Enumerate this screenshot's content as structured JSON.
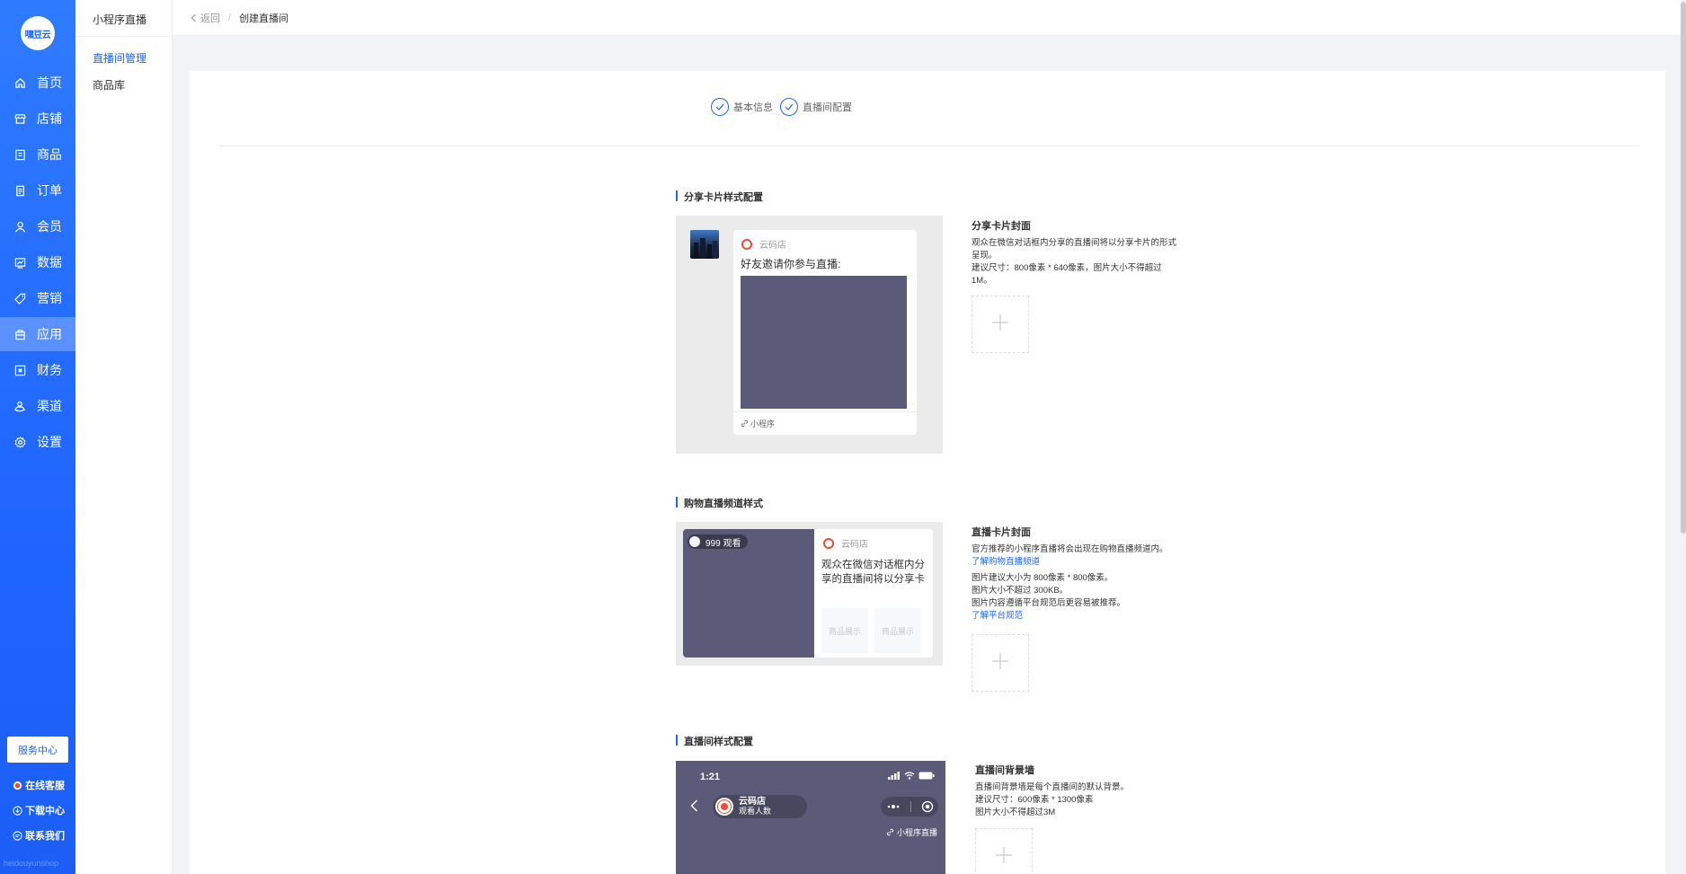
{
  "brand": {
    "logo_text": "嘿豆云",
    "accent": "#1f65ff",
    "watermark": "heidouyunshop"
  },
  "nav": {
    "items": [
      {
        "label": "首页",
        "icon": "home-icon"
      },
      {
        "label": "店铺",
        "icon": "store-icon"
      },
      {
        "label": "商品",
        "icon": "goods-icon"
      },
      {
        "label": "订单",
        "icon": "order-icon"
      },
      {
        "label": "会员",
        "icon": "user-icon"
      },
      {
        "label": "数据",
        "icon": "chart-icon"
      },
      {
        "label": "营销",
        "icon": "tag-icon"
      },
      {
        "label": "应用",
        "icon": "app-icon",
        "active": true
      },
      {
        "label": "财务",
        "icon": "finance-icon"
      },
      {
        "label": "渠道",
        "icon": "channel-icon"
      },
      {
        "label": "设置",
        "icon": "gear-icon"
      }
    ],
    "service_center": "服务中心",
    "footer_links": [
      {
        "label": "在线客服",
        "icon": "chat-icon"
      },
      {
        "label": "下载中心",
        "icon": "download-icon"
      },
      {
        "label": "联系我们",
        "icon": "contact-icon"
      }
    ]
  },
  "subnav": {
    "title": "小程序直播",
    "items": [
      {
        "label": "直播间管理",
        "active": true
      },
      {
        "label": "商品库"
      }
    ]
  },
  "breadcrumb": {
    "back": "返回",
    "current": "创建直播间"
  },
  "steps": [
    {
      "label": "基本信息"
    },
    {
      "label": "直播间配置"
    }
  ],
  "sections": {
    "share_card": {
      "title": "分享卡片样式配置",
      "preview": {
        "shop_name": "云码店",
        "invite_text": "好友邀请你参与直播:",
        "footer": "小程序"
      },
      "right_title": "分享卡片封面",
      "desc_1": "观众在微信对话框内分享的直播间将以分享卡片的形式",
      "desc_2": "呈现。",
      "desc_3": "建议尺寸：800像素 * 640像素，图片大小不得超过",
      "desc_4": "1M。"
    },
    "channel_style": {
      "title": "购物直播频道样式",
      "preview": {
        "viewers": "999 观看",
        "shop_name": "云码店",
        "desc": "观众在微信对话框内分享的直播间将以分享卡",
        "goods_1": "商品展示",
        "goods_2": "商品展示"
      },
      "right_title": "直播卡片封面",
      "desc_1": "官方推荐的小程序直播将会出现在购物直播频道内。",
      "link_1": "了解购物直播频道",
      "desc_2": "图片建议大小为 800像素 * 800像素。",
      "desc_3": "图片大小不超过 300KB。",
      "desc_4": "图片内容遵循平台规范后更容易被推荐。",
      "link_2": "了解平台规范"
    },
    "room_style": {
      "title": "直播间样式配置",
      "preview": {
        "time": "1:21",
        "shop_name": "云码店",
        "viewers_label": "观看人数",
        "tag": "小程序直播"
      },
      "right_title": "直播间背景墙",
      "desc_1": "直播间背景墙是每个直播间的默认背景。",
      "desc_2": "建议尺寸：600像素 * 1300像素",
      "desc_3": "图片大小不得超过3M"
    }
  }
}
